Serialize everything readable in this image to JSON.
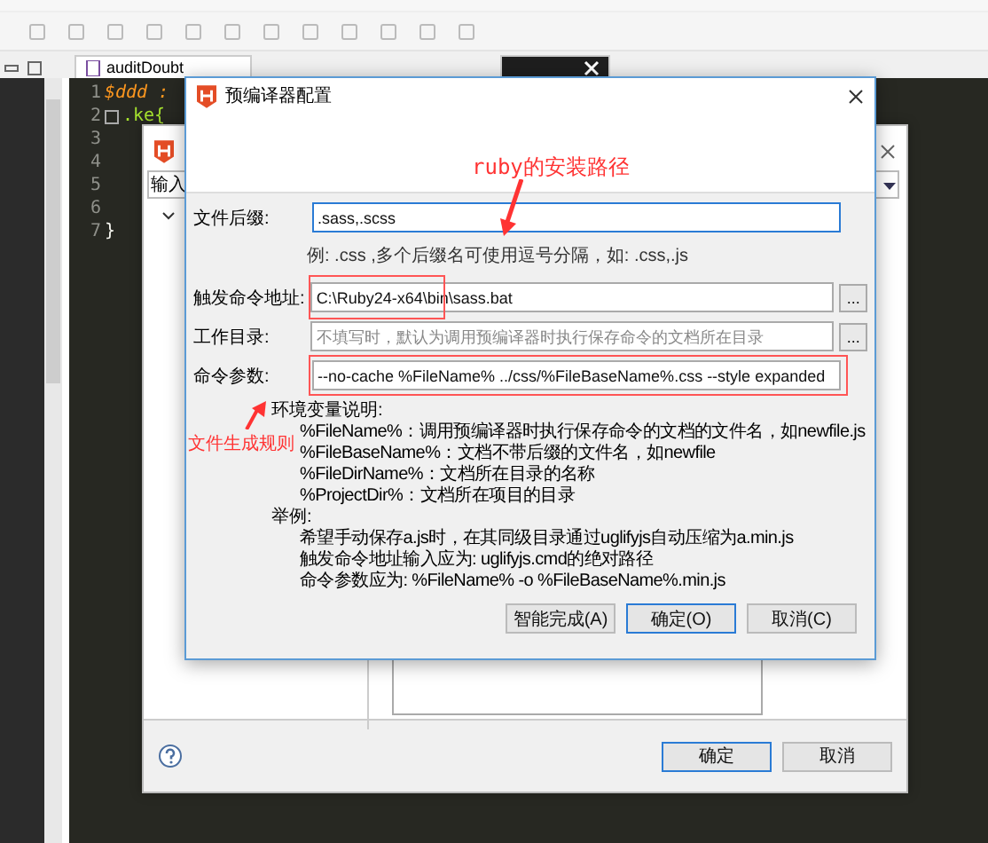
{
  "editor_tabs": [
    {
      "label": "auditDoubt",
      "selected": false
    },
    {
      "selected": true
    }
  ],
  "code_lines": [
    {
      "number": "1",
      "text": "$ddd :",
      "kind": "variable"
    },
    {
      "number": "2",
      "text": ".ke{",
      "kind": "selector"
    },
    {
      "number": "3"
    },
    {
      "number": "4"
    },
    {
      "number": "5"
    },
    {
      "number": "6"
    },
    {
      "number": "7",
      "text": "}",
      "kind": "plain"
    }
  ],
  "background_dialog": {
    "input_text": "输入",
    "buttons": [
      {
        "label": "确定",
        "default": true
      },
      {
        "label": "取消",
        "default": false
      }
    ]
  },
  "dialog": {
    "title": "预编译器配置",
    "fields": [
      {
        "label": "文件后缀:",
        "value": ".sass,.scss",
        "focused": true,
        "hint": "例: .css ,多个后缀名可使用逗号分隔，如: .css,.js"
      },
      {
        "label": "触发命令地址:",
        "value": "C:\\Ruby24-x64\\bin\\sass.bat",
        "focused": false,
        "browse": "..."
      },
      {
        "label": "工作目录:",
        "placeholder": "不填写时，默认为调用预编译器时执行保存命令的文档所在目录",
        "focused": false,
        "browse": "..."
      },
      {
        "label": "命令参数:",
        "value": "--no-cache %FileName% ../css/%FileBaseName%.css --style expanded",
        "focused": false
      }
    ],
    "help": [
      {
        "heading": "环境变量说明:",
        "items": [
          "%FileName%：调用预编译器时执行保存命令的文档的文件名，如newfile.js",
          "%FileBaseName%：文档不带后缀的文件名，如newfile",
          "%FileDirName%：文档所在目录的名称",
          "%ProjectDir%：文档所在项目的目录"
        ]
      },
      {
        "heading": "举例:",
        "items": [
          "希望手动保存a.js时，在其同级目录通过uglifyjs自动压缩为a.min.js",
          "触发命令地址输入应为: uglifyjs.cmd的绝对路径",
          "命令参数应为: %FileName% -o %FileBaseName%.min.js"
        ]
      }
    ],
    "buttons": [
      {
        "label": "智能完成(A)",
        "default": false
      },
      {
        "label": "确定(O)",
        "default": true
      },
      {
        "label": "取消(C)",
        "default": false
      }
    ]
  },
  "annotations": [
    {
      "text": "ruby的安装路径"
    },
    {
      "text": "文件生成规则"
    }
  ]
}
